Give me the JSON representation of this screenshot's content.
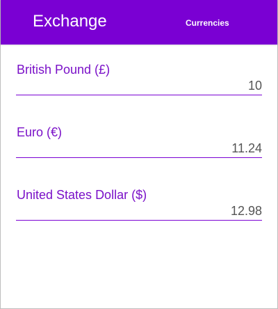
{
  "header": {
    "title": "Exchange",
    "nav_link": "Currencies"
  },
  "fields": [
    {
      "label": "British Pound (£)",
      "value": "10"
    },
    {
      "label": "Euro (€)",
      "value": "11.24"
    },
    {
      "label": "United States Dollar ($)",
      "value": "12.98"
    }
  ],
  "colors": {
    "brand": "#7a00d3",
    "label": "#7a10c8",
    "value": "#555555"
  }
}
